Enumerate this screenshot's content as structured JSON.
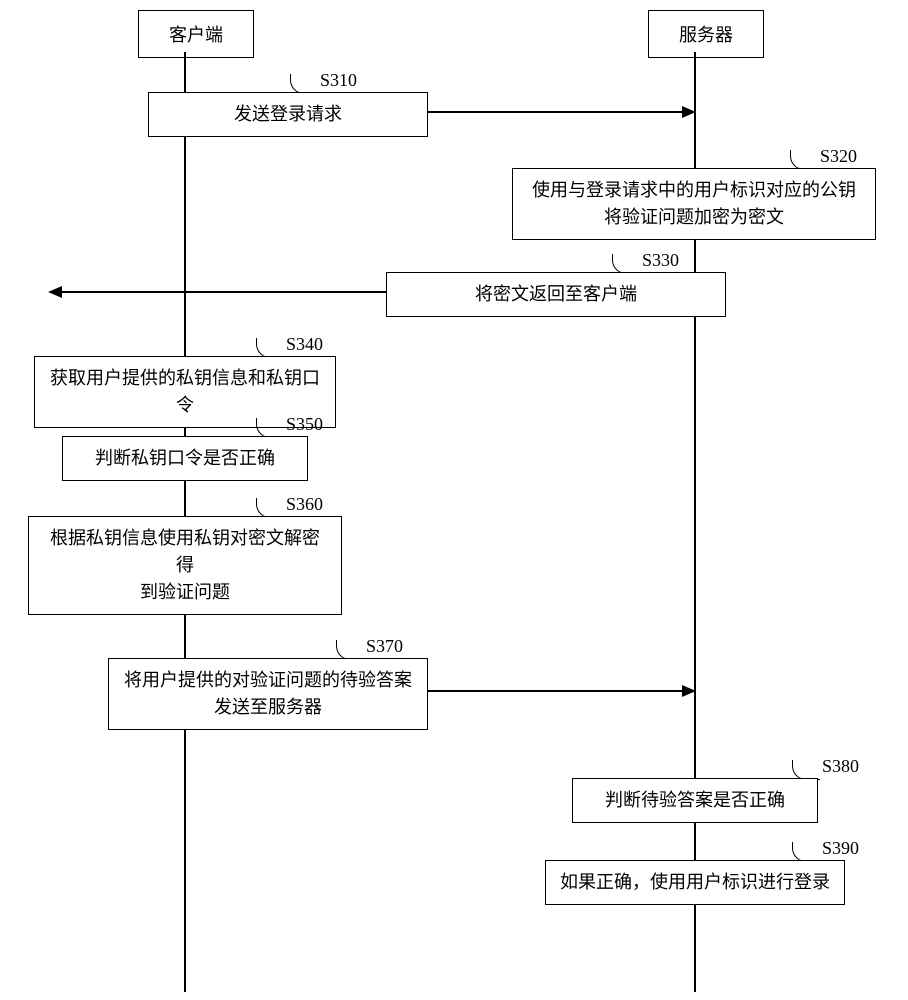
{
  "participants": {
    "client": "客户端",
    "server": "服务器"
  },
  "steps": {
    "s310": {
      "label": "S310",
      "text": "发送登录请求"
    },
    "s320": {
      "label": "S320",
      "text_line1": "使用与登录请求中的用户标识对应的公钥",
      "text_line2": "将验证问题加密为密文"
    },
    "s330": {
      "label": "S330",
      "text": "将密文返回至客户端"
    },
    "s340": {
      "label": "S340",
      "text": "获取用户提供的私钥信息和私钥口令"
    },
    "s350": {
      "label": "S350",
      "text": "判断私钥口令是否正确"
    },
    "s360": {
      "label": "S360",
      "text_line1": "根据私钥信息使用私钥对密文解密得",
      "text_line2": "到验证问题"
    },
    "s370": {
      "label": "S370",
      "text_line1": "将用户提供的对验证问题的待验答案",
      "text_line2": "发送至服务器"
    },
    "s380": {
      "label": "S380",
      "text": "判断待验答案是否正确"
    },
    "s390": {
      "label": "S390",
      "text": "如果正确，使用用户标识进行登录"
    }
  }
}
